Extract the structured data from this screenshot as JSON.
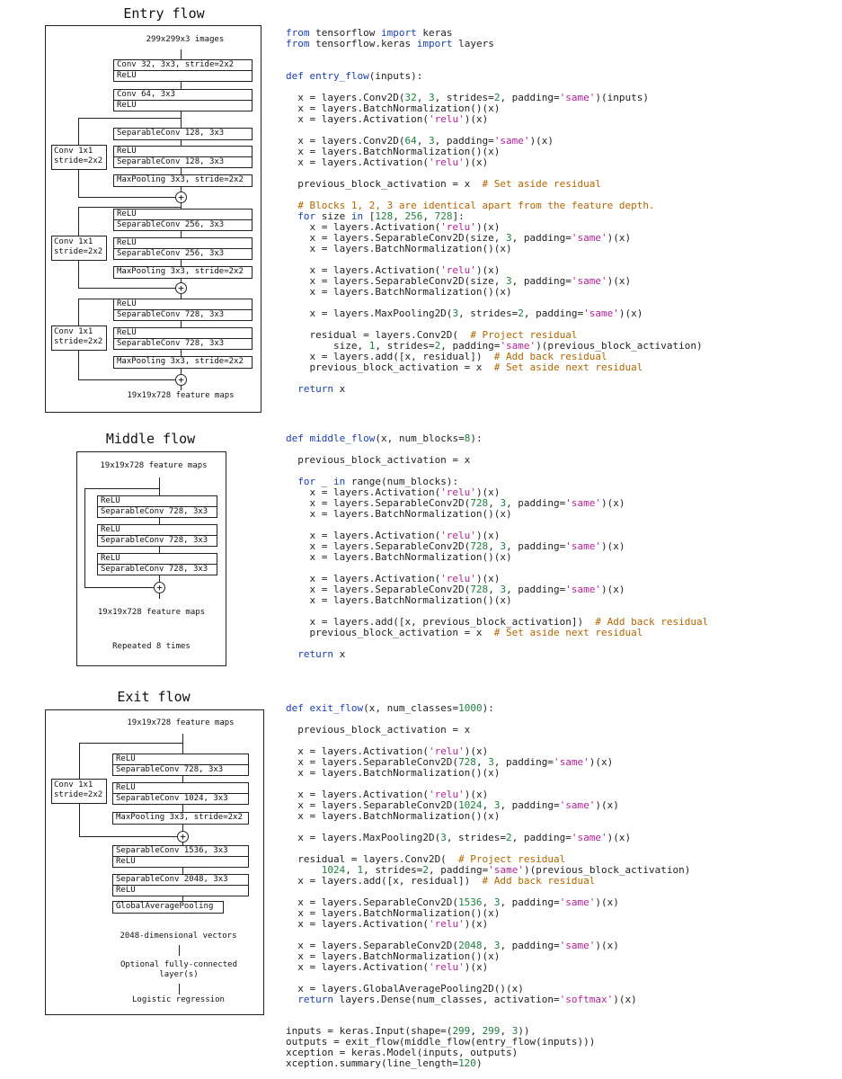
{
  "entry_flow": {
    "title": "Entry flow",
    "input_label": "299x299x3 images",
    "output_label": "19x19x728 feature maps",
    "layers": {
      "conv32": "Conv 32, 3x3, stride=2x2",
      "relu": "ReLU",
      "conv64": "Conv 64, 3x3",
      "sep128": "SeparableConv 128, 3x3",
      "maxpool": "MaxPooling 3x3, stride=2x2",
      "sep256": "SeparableConv 256, 3x3",
      "sep728": "SeparableConv 728, 3x3"
    },
    "shortcut_conv": "Conv 1x1 stride=2x2"
  },
  "middle_flow": {
    "title": "Middle flow",
    "input_label": "19x19x728 feature maps",
    "output_label": "19x19x728 feature maps",
    "repeat_label": "Repeated 8 times",
    "layers": {
      "relu": "ReLU",
      "sep728": "SeparableConv 728, 3x3"
    }
  },
  "exit_flow": {
    "title": "Exit flow",
    "input_label": "19x19x728 feature maps",
    "layers": {
      "relu": "ReLU",
      "sep728": "SeparableConv 728, 3x3",
      "sep1024": "SeparableConv 1024, 3x3",
      "maxpool": "MaxPooling 3x3, stride=2x2",
      "sep1536": "SeparableConv 1536, 3x3",
      "sep2048": "SeparableConv 2048, 3x3",
      "gap": "GlobalAveragePooling"
    },
    "shortcut_conv": "Conv 1x1 stride=2x2",
    "vectors_label": "2048-dimensional vectors",
    "fc_label": "Optional fully-connected layer(s)",
    "logreg_label": "Logistic regression"
  },
  "code": {
    "entry": "from tensorflow import keras\nfrom tensorflow.keras import layers\n\n\ndef entry_flow(inputs):\n\n  x = layers.Conv2D(32, 3, strides=2, padding='same')(inputs)\n  x = layers.BatchNormalization()(x)\n  x = layers.Activation('relu')(x)\n\n  x = layers.Conv2D(64, 3, padding='same')(x)\n  x = layers.BatchNormalization()(x)\n  x = layers.Activation('relu')(x)\n\n  previous_block_activation = x  # Set aside residual\n\n  # Blocks 1, 2, 3 are identical apart from the feature depth.\n  for size in [128, 256, 728]:\n    x = layers.Activation('relu')(x)\n    x = layers.SeparableConv2D(size, 3, padding='same')(x)\n    x = layers.BatchNormalization()(x)\n\n    x = layers.Activation('relu')(x)\n    x = layers.SeparableConv2D(size, 3, padding='same')(x)\n    x = layers.BatchNormalization()(x)\n\n    x = layers.MaxPooling2D(3, strides=2, padding='same')(x)\n\n    residual = layers.Conv2D(  # Project residual\n        size, 1, strides=2, padding='same')(previous_block_activation)\n    x = layers.add([x, residual])  # Add back residual\n    previous_block_activation = x  # Set aside next residual\n\n  return x",
    "middle": "def middle_flow(x, num_blocks=8):\n\n  previous_block_activation = x\n\n  for _ in range(num_blocks):\n    x = layers.Activation('relu')(x)\n    x = layers.SeparableConv2D(728, 3, padding='same')(x)\n    x = layers.BatchNormalization()(x)\n\n    x = layers.Activation('relu')(x)\n    x = layers.SeparableConv2D(728, 3, padding='same')(x)\n    x = layers.BatchNormalization()(x)\n\n    x = layers.Activation('relu')(x)\n    x = layers.SeparableConv2D(728, 3, padding='same')(x)\n    x = layers.BatchNormalization()(x)\n\n    x = layers.add([x, previous_block_activation])  # Add back residual\n    previous_block_activation = x  # Set aside next residual\n\n  return x",
    "exit": "def exit_flow(x, num_classes=1000):\n\n  previous_block_activation = x\n\n  x = layers.Activation('relu')(x)\n  x = layers.SeparableConv2D(728, 3, padding='same')(x)\n  x = layers.BatchNormalization()(x)\n\n  x = layers.Activation('relu')(x)\n  x = layers.SeparableConv2D(1024, 3, padding='same')(x)\n  x = layers.BatchNormalization()(x)\n\n  x = layers.MaxPooling2D(3, strides=2, padding='same')(x)\n\n  residual = layers.Conv2D(  # Project residual\n      1024, 1, strides=2, padding='same')(previous_block_activation)\n  x = layers.add([x, residual])  # Add back residual\n\n  x = layers.SeparableConv2D(1536, 3, padding='same')(x)\n  x = layers.BatchNormalization()(x)\n  x = layers.Activation('relu')(x)\n\n  x = layers.SeparableConv2D(2048, 3, padding='same')(x)\n  x = layers.BatchNormalization()(x)\n  x = layers.Activation('relu')(x)\n\n  x = layers.GlobalAveragePooling2D()(x)\n  return layers.Dense(num_classes, activation='softmax')(x)",
    "main": "inputs = keras.Input(shape=(299, 299, 3))\noutputs = exit_flow(middle_flow(entry_flow(inputs)))\nxception = keras.Model(inputs, outputs)\nxception.summary(line_length=120)"
  }
}
